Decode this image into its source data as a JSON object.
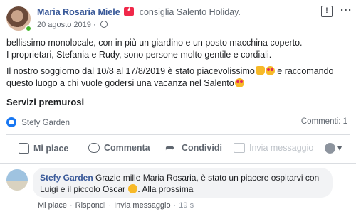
{
  "post": {
    "author": "Maria Rosaria Miele",
    "recommend_text": "consiglia Salento Holiday.",
    "date": "20 agosto 2019",
    "meta_separator": "·",
    "body_line1": "bellissimo monolocale, con in più un giardino e un posto macchina coperto.",
    "body_line2": "I proprietari, Stefania e Rudy, sono persone molto gentile e cordiali.",
    "body_line3_a": "Il nostro soggiorno dal 10/8 al 17/8/2019 è stato piacevolissimo",
    "body_line3_b": " e raccomando",
    "body_line4": "questo luogo a chi vuole godersi una vacanza nel Salento",
    "services": "Servizi premurosi",
    "report_icon_glyph": "!",
    "more_icon_glyph": "···"
  },
  "reactions": {
    "liker": "Stefy Garden",
    "comments_count": "Commenti: 1"
  },
  "actions": {
    "like": "Mi piace",
    "comment": "Commenta",
    "share": "Condividi",
    "send": "Invia messaggio",
    "caret": "▼"
  },
  "comment": {
    "author": "Stefy Garden",
    "text_a": " Grazie mille Maria Rosaria, è stato un piacere ospitarvi con",
    "text_b": "Luigi e il piccolo Oscar",
    "text_c": ". Alla prossima",
    "like": "Mi piace",
    "reply": "Rispondi",
    "send": "Invia messaggio",
    "time": "19 s",
    "separator": "·"
  },
  "colors": {
    "author_link": "#385898",
    "like_blue": "#1877f2",
    "muted_text": "#606770",
    "bubble_bg": "#f2f3f5",
    "online_green": "#42b72a",
    "recommend_red": "#f02849"
  },
  "icons": [
    "recommend-icon",
    "globe-icon",
    "report-icon",
    "more-icon",
    "like-icon",
    "comment-icon",
    "share-icon",
    "messenger-icon",
    "audience-icon",
    "thumbs-up-emoji",
    "heart-eyes-emoji",
    "smile-emoji"
  ]
}
